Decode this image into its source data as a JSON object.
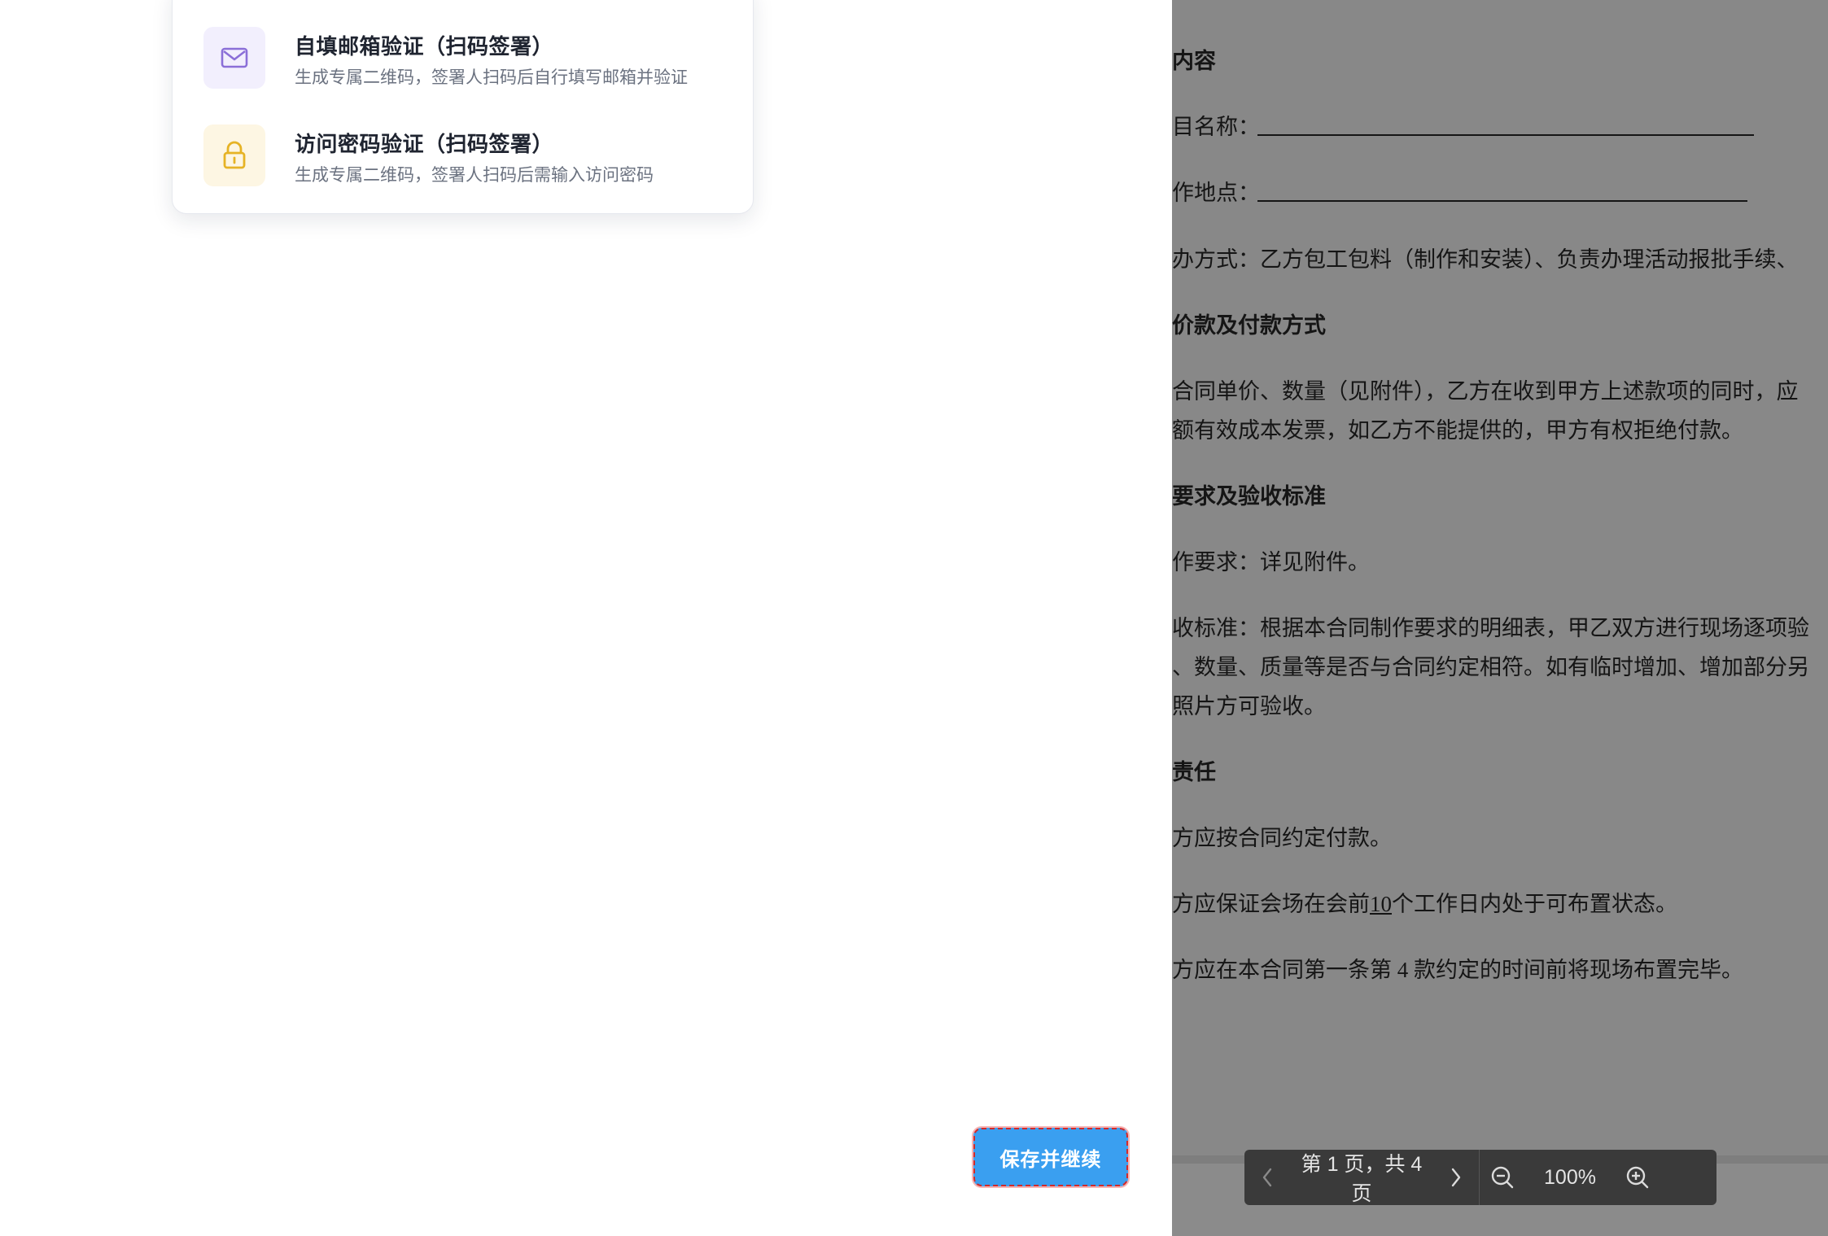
{
  "verification_options": [
    {
      "title": "自填邮箱验证（扫码签署）",
      "description": "生成专属二维码，签署人扫码后自行填写邮箱并验证",
      "icon": "mail-icon"
    },
    {
      "title": "访问密码验证（扫码签署）",
      "description": "生成专属二维码，签署人扫码后需输入访问密码",
      "icon": "lock-icon"
    }
  ],
  "save_button_label": "保存并继续",
  "document": {
    "lines": [
      {
        "text": "内容",
        "heading": true
      },
      {
        "text": "目名称：",
        "heading": false
      },
      {
        "text": "作地点：",
        "heading": false
      },
      {
        "text": "办方式：乙方包工包料（制作和安装）、负责办理活动报批手续、",
        "heading": false
      },
      {
        "text": "价款及付款方式",
        "heading": true
      },
      {
        "text": "合同单价、数量（见附件），乙方在收到甲方上述款项的同时，应",
        "heading": false
      },
      {
        "text": "额有效成本发票，如乙方不能提供的，甲方有权拒绝付款。",
        "heading": false
      },
      {
        "text": "要求及验收标准",
        "heading": true
      },
      {
        "text": "作要求：详见附件。",
        "heading": false
      },
      {
        "text": "收标准：根据本合同制作要求的明细表，甲乙双方进行现场逐项验",
        "heading": false
      },
      {
        "text": "、数量、质量等是否与合同约定相符。如有临时增加、增加部分另",
        "heading": false
      },
      {
        "text": "照片方可验收。",
        "heading": false
      },
      {
        "text": "责任",
        "heading": true
      },
      {
        "text": "方应按合同约定付款。",
        "heading": false
      },
      {
        "text_before": "方应保证会场在会前",
        "underlined": "10",
        "text_after": "个工作日内处于可布置状态。"
      },
      {
        "text": "方应在本合同第一条第 4 款约定的时间前将现场布置完毕。",
        "heading": false
      }
    ]
  },
  "viewer_toolbar": {
    "page_indicator": "第 1 页，共 4 页",
    "zoom": "100%"
  },
  "colors": {
    "primary_button": "#3a9ff0",
    "doc_overlay": "#888888",
    "toolbar_bg": "#3a3a3a"
  }
}
